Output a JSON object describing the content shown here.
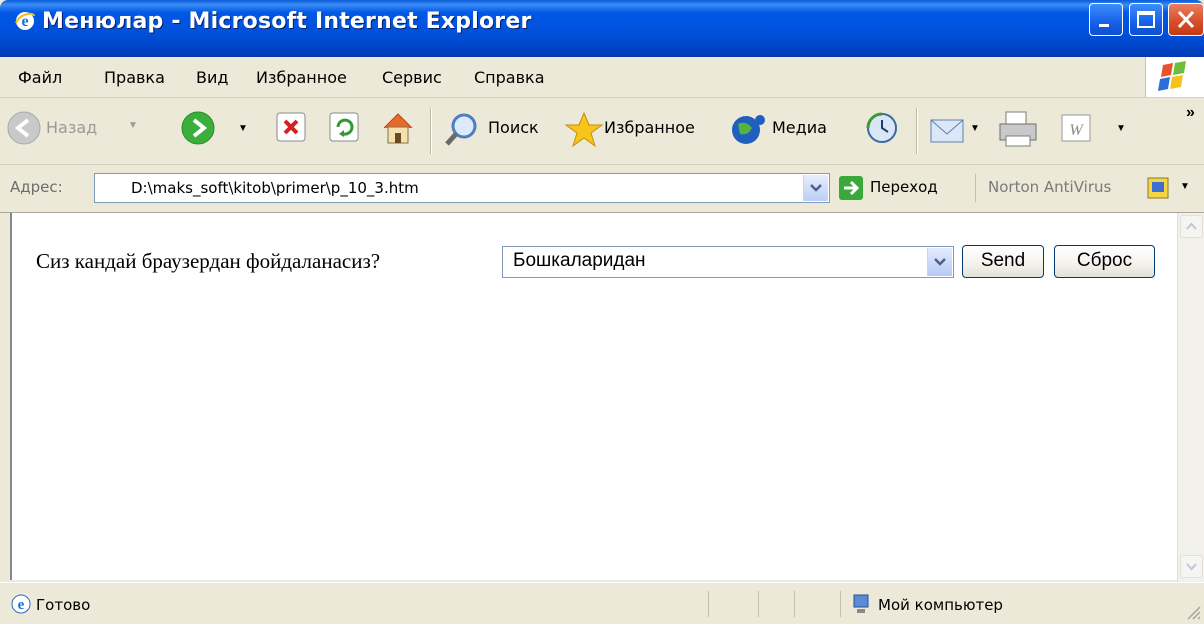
{
  "window": {
    "title": "Менюлар - Microsoft Internet Explorer",
    "icon": "ie-icon",
    "controls": [
      "minimize",
      "maximize",
      "close"
    ]
  },
  "menu": {
    "items": [
      "Файл",
      "Правка",
      "Вид",
      "Избранное",
      "Сервис",
      "Справка"
    ]
  },
  "toolbar": {
    "back_label": "Назад",
    "search_label": "Поиск",
    "favorites_label": "Избранное",
    "media_label": "Медиа",
    "overflow": "»"
  },
  "address": {
    "label": "Адрес:",
    "value": "D:\\maks_soft\\kitob\\primer\\p_10_3.htm",
    "go_label": "Переход",
    "norton_label": "Norton AntiVirus"
  },
  "page": {
    "question": "Сиз кандай браузердан фойдаланасиз?",
    "select_value": "Бошкаларидан",
    "send_label": "Send",
    "reset_label": "Сброс"
  },
  "status": {
    "text": "Готово",
    "zone": "Мой компьютер"
  },
  "colors": {
    "titlebar": "#0054e3",
    "close": "#d8502b",
    "chrome": "#ece9d8"
  }
}
